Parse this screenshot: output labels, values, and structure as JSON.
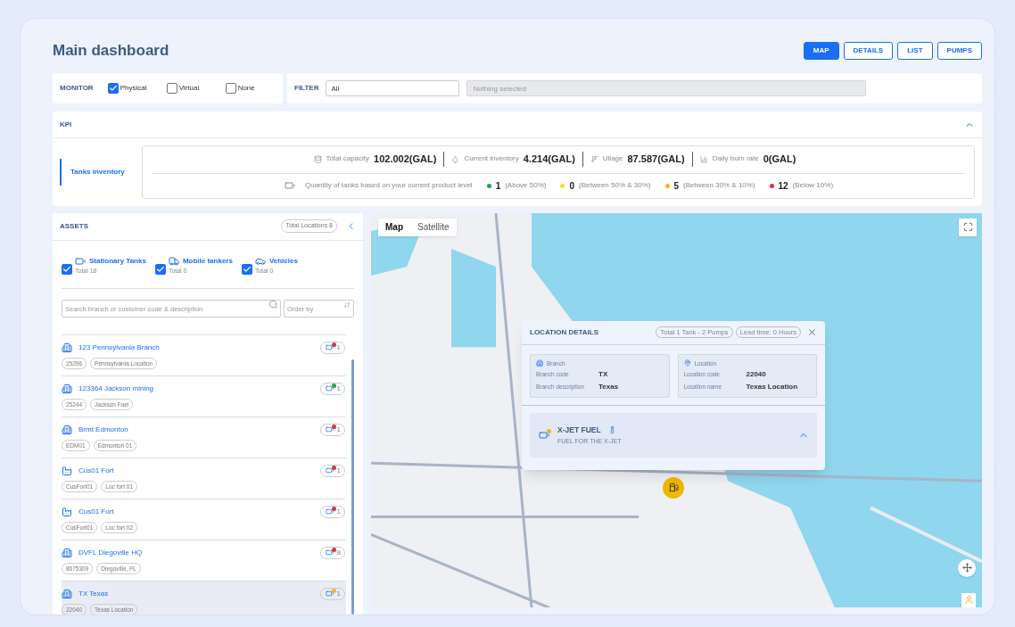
{
  "title": "Main dashboard",
  "view_tabs": [
    {
      "label": "MAP",
      "selected": true
    },
    {
      "label": "DETAILS",
      "selected": false
    },
    {
      "label": "LIST",
      "selected": false
    },
    {
      "label": "PUMPS",
      "selected": false
    }
  ],
  "monitor": {
    "label": "MONITOR",
    "options": [
      {
        "label": "Physical",
        "checked": true
      },
      {
        "label": "Virtual",
        "checked": false
      },
      {
        "label": "None",
        "checked": false
      }
    ]
  },
  "filter": {
    "label": "FILTER",
    "value": "All",
    "placeholder": "Nothing selected"
  },
  "kpi": {
    "title": "KPI",
    "expanded": true,
    "section": "Tanks inventory",
    "metrics": [
      {
        "kind": "capacity",
        "label": "Total capacity",
        "value": "102.002(GAL)"
      },
      {
        "kind": "inventory",
        "label": "Current inventory",
        "value": "4.214(GAL)"
      },
      {
        "kind": "ullage",
        "label": "Ullage",
        "value": "87.587(GAL)"
      },
      {
        "kind": "burn",
        "label": "Daily burn rate",
        "value": "0(GAL)"
      }
    ],
    "levels_label": "Quantity of tanks based on your current product level",
    "levels": [
      {
        "count": "1",
        "range": "(Above 50%)",
        "color": "#22a447"
      },
      {
        "count": "0",
        "range": "(Between 50% & 30%)",
        "color": "#f5e31b"
      },
      {
        "count": "5",
        "range": "(Between 30% & 10%)",
        "color": "#f5b41b"
      },
      {
        "count": "12",
        "range": "(Below 10%)",
        "color": "#e0323c"
      }
    ]
  },
  "assets": {
    "title": "ASSETS",
    "total": "Total Locations 8",
    "types": [
      {
        "kind": "tank",
        "label": "Stationary Tanks",
        "total": "Total 18",
        "checked": true
      },
      {
        "kind": "tanker",
        "label": "Mobile tankers",
        "total": "Total 0",
        "checked": true
      },
      {
        "kind": "vehicle",
        "label": "Vehicles",
        "total": "Total 0",
        "checked": true
      }
    ],
    "search_placeholder": "Search branch or customer code & description",
    "order_placeholder": "Order by",
    "items": [
      {
        "kind": "branch",
        "name": "123 Pennsylvania Branch",
        "tags": [
          "25296",
          "Pennsylvania Location"
        ],
        "count": "1",
        "color": "#e0323c",
        "selected": false
      },
      {
        "kind": "branch",
        "name": "123364 Jackson mining",
        "tags": [
          "25244",
          "Jackson Fuel"
        ],
        "count": "1",
        "color": "#22a447",
        "selected": false
      },
      {
        "kind": "branch",
        "name": "Brmt Edmonton",
        "tags": [
          "EDM01",
          "Edmonton 01"
        ],
        "count": "1",
        "color": "#e0323c",
        "selected": false
      },
      {
        "kind": "factory",
        "name": "Cus01 Fort",
        "tags": [
          "CusFort01",
          "Loc fort 01"
        ],
        "count": "1",
        "color": "#e0323c",
        "selected": false
      },
      {
        "kind": "factory",
        "name": "Cus01 Fort",
        "tags": [
          "CusFort01",
          "Loc fort 02"
        ],
        "count": "1",
        "color": "#e0323c",
        "selected": false
      },
      {
        "kind": "branch",
        "name": "DVFL Diegoville HQ",
        "tags": [
          "8675309",
          "Diegoville, FL"
        ],
        "count": "8",
        "color": "#e0323c",
        "selected": false
      },
      {
        "kind": "branch",
        "name": "TX Texas",
        "tags": [
          "22040",
          "Texas Location"
        ],
        "count": "1",
        "color": "#f5b41b",
        "selected": true
      }
    ]
  },
  "map": {
    "modes": [
      {
        "label": "Map",
        "selected": true
      },
      {
        "label": "Satellite",
        "selected": false
      }
    ],
    "details": {
      "title": "LOCATION DETAILS",
      "badges": [
        "Total 1 Tank - 2 Pumps",
        "Lead time: 0 Hours"
      ],
      "branch": {
        "title": "Branch",
        "rows": [
          {
            "label": "Branch code",
            "value": "TX"
          },
          {
            "label": "Branch description",
            "value": "Texas"
          }
        ]
      },
      "location": {
        "title": "Location",
        "rows": [
          {
            "label": "Location code",
            "value": "22040"
          },
          {
            "label": "Location name",
            "value": "Texas Location"
          }
        ]
      },
      "product": {
        "name": "X-JET FUEL",
        "description": "FUEL FOR THE X-JET",
        "color": "#f5b41b",
        "expanded": true
      }
    }
  }
}
